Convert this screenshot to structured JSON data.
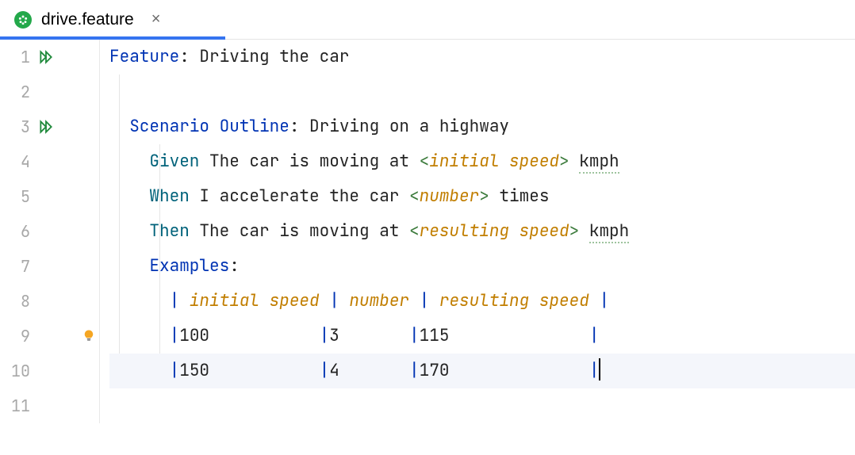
{
  "tab": {
    "filename": "drive.feature"
  },
  "lines": {
    "l1": {
      "num": "1",
      "keyword": "Feature",
      "colon": ":",
      "text": " Driving the car"
    },
    "l2": {
      "num": "2"
    },
    "l3": {
      "num": "3",
      "keyword": "Scenario Outline",
      "colon": ":",
      "text": " Driving on a highway"
    },
    "l4": {
      "num": "4",
      "keyword": "Given",
      "text1": " The car is moving at ",
      "open": "<",
      "param": "initial speed",
      "close": ">",
      "text2": " ",
      "tail": "kmph"
    },
    "l5": {
      "num": "5",
      "keyword": "When",
      "text1": " I accelerate the car ",
      "open": "<",
      "param": "number",
      "close": ">",
      "text2": " times"
    },
    "l6": {
      "num": "6",
      "keyword": "Then",
      "text1": " The car is moving at ",
      "open": "<",
      "param": "resulting speed",
      "close": ">",
      "text2": " ",
      "tail": "kmph"
    },
    "l7": {
      "num": "7",
      "keyword": "Examples",
      "colon": ":"
    },
    "l8": {
      "num": "8",
      "p1": "|",
      "c1": " initial speed ",
      "p2": "|",
      "c2": " number ",
      "p3": "|",
      "c3": " resulting speed ",
      "p4": "|"
    },
    "l9": {
      "num": "9",
      "p1": "|",
      "c1": "100           ",
      "p2": "|",
      "c2": "3       ",
      "p3": "|",
      "c3": "115              ",
      "p4": "|"
    },
    "l10": {
      "num": "10",
      "p1": "|",
      "c1": "150           ",
      "p2": "|",
      "c2": "4       ",
      "p3": "|",
      "c3": "170              ",
      "p4": "|"
    },
    "l11": {
      "num": "11"
    }
  }
}
